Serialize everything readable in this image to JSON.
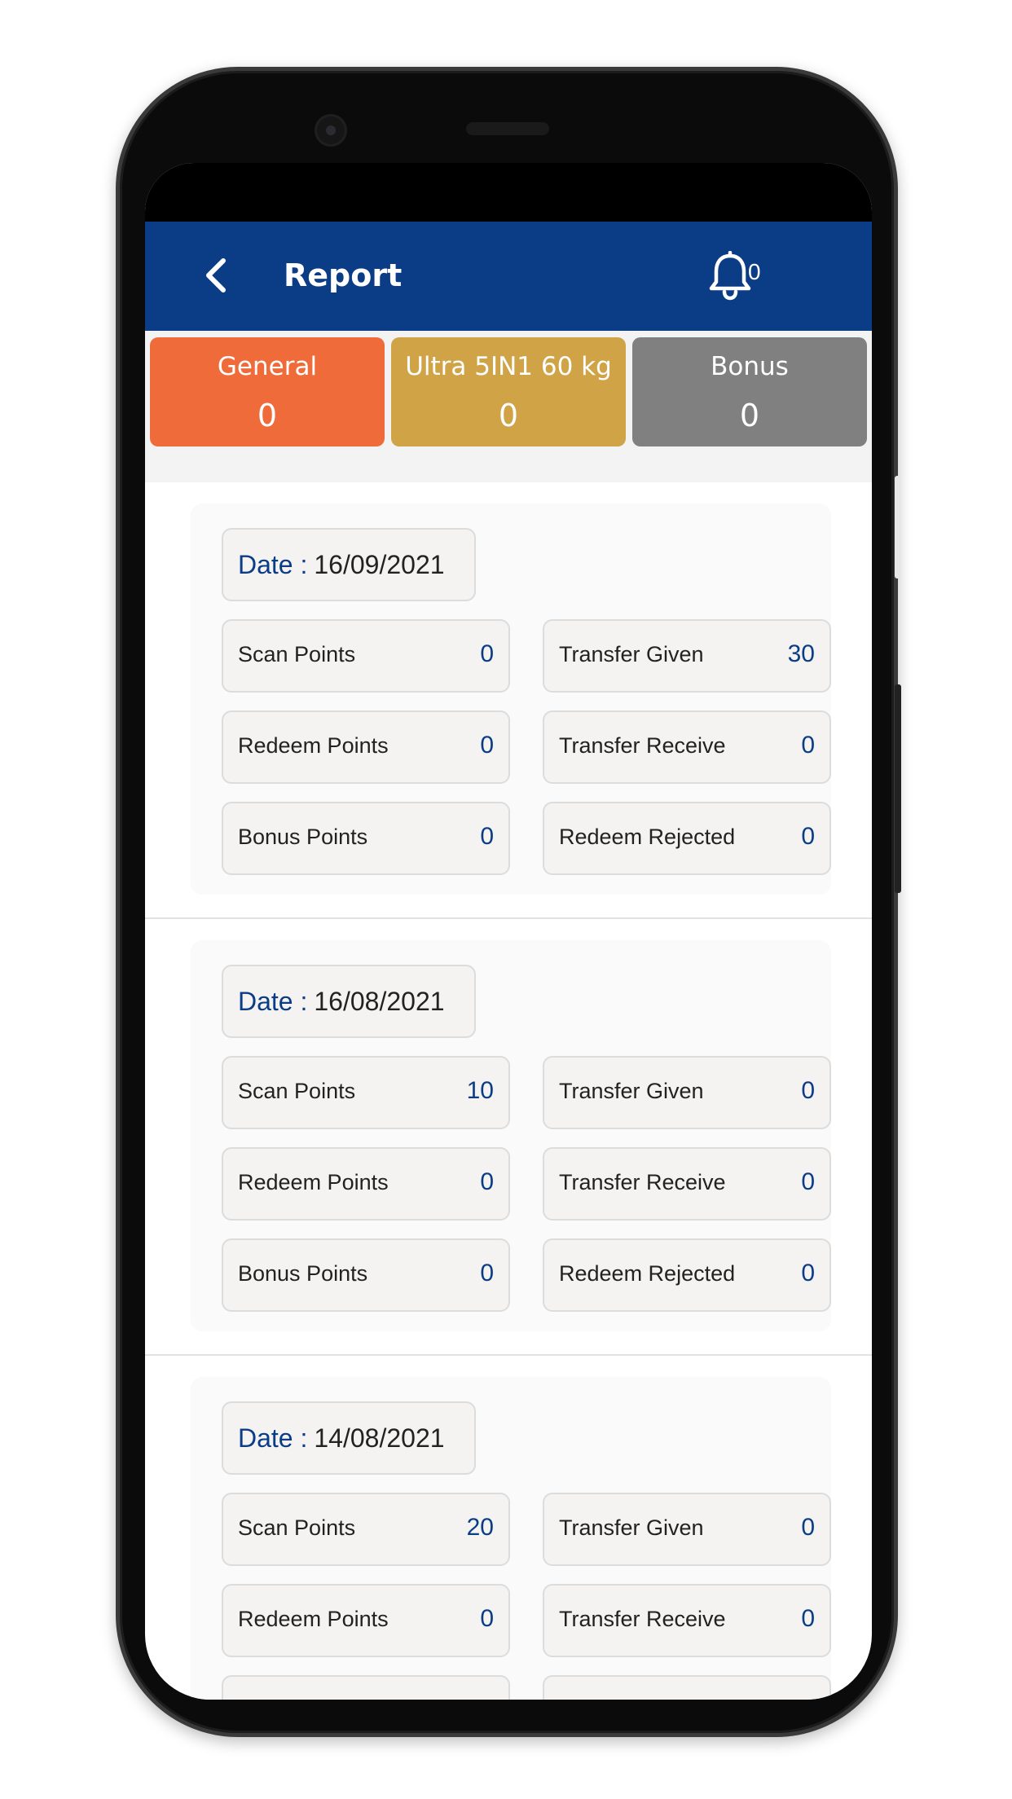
{
  "header": {
    "title": "Report",
    "notification_count": "0"
  },
  "tabs": [
    {
      "label": "General",
      "value": "0",
      "color": "#ef6c3a"
    },
    {
      "label": "Ultra 5IN1 60 kg",
      "value": "0",
      "color": "#cfa346"
    },
    {
      "label": "Bonus",
      "value": "0",
      "color": "#808080"
    }
  ],
  "reports": [
    {
      "date_label": "Date :",
      "date": "16/09/2021",
      "left": [
        {
          "label": "Scan Points",
          "value": "0"
        },
        {
          "label": "Redeem Points",
          "value": "0"
        },
        {
          "label": "Bonus Points",
          "value": "0"
        }
      ],
      "right": [
        {
          "label": "Transfer Given",
          "value": "30"
        },
        {
          "label": "Transfer Receive",
          "value": "0"
        },
        {
          "label": "Redeem Rejected",
          "value": "0"
        }
      ]
    },
    {
      "date_label": "Date :",
      "date": "16/08/2021",
      "left": [
        {
          "label": "Scan Points",
          "value": "10"
        },
        {
          "label": "Redeem Points",
          "value": "0"
        },
        {
          "label": "Bonus Points",
          "value": "0"
        }
      ],
      "right": [
        {
          "label": "Transfer Given",
          "value": "0"
        },
        {
          "label": "Transfer Receive",
          "value": "0"
        },
        {
          "label": "Redeem Rejected",
          "value": "0"
        }
      ]
    },
    {
      "date_label": "Date :",
      "date": "14/08/2021",
      "left": [
        {
          "label": "Scan Points",
          "value": "20"
        },
        {
          "label": "Redeem Points",
          "value": "0"
        }
      ],
      "right": [
        {
          "label": "Transfer Given",
          "value": "0"
        },
        {
          "label": "Transfer Receive",
          "value": "0"
        }
      ]
    }
  ],
  "icons": {
    "back": "chevron-left-icon",
    "notifications": "bell-icon"
  },
  "colors": {
    "primary": "#0b3d86",
    "value_text": "#0b3d86"
  }
}
